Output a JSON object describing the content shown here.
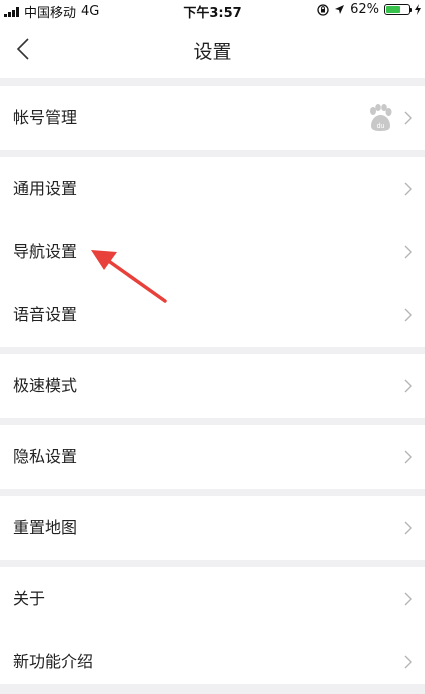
{
  "status_bar": {
    "carrier": "中国移动",
    "network": "4G",
    "time": "下午3:57",
    "battery_percent": "62%",
    "battery_level": 0.62,
    "battery_color": "#38c24b"
  },
  "header": {
    "title": "设置"
  },
  "menu": {
    "account": "帐号管理",
    "general": "通用设置",
    "navigation": "导航设置",
    "voice": "语音设置",
    "speed_mode": "极速模式",
    "privacy": "隐私设置",
    "reset_map": "重置地图",
    "about": "关于",
    "new_features": "新功能介绍"
  },
  "annotation": {
    "arrow_color": "#e8403a"
  }
}
